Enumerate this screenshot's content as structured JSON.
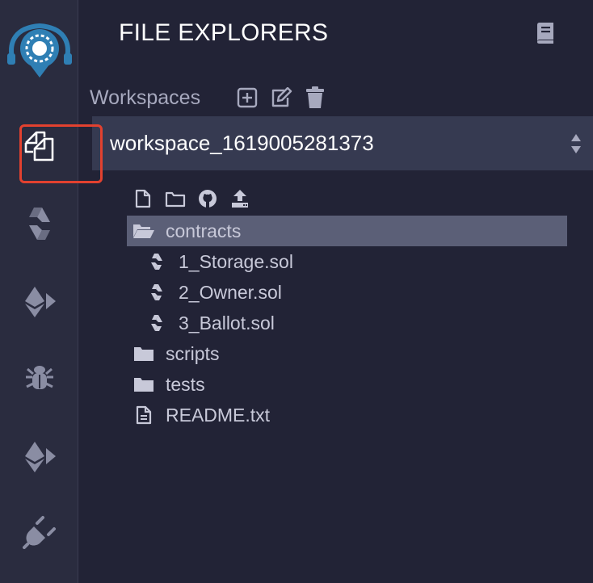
{
  "rail": {
    "items": [
      {
        "name": "remix-logo"
      },
      {
        "name": "file-explorer"
      },
      {
        "name": "solidity-compiler"
      },
      {
        "name": "deploy-run"
      },
      {
        "name": "debugger"
      },
      {
        "name": "ethereum-plugin"
      },
      {
        "name": "plugin-manager"
      }
    ]
  },
  "panel": {
    "title": "FILE EXPLORERS",
    "workspaces_label": "Workspaces",
    "workspace_selected": "workspace_1619005281373"
  },
  "tree": {
    "items": [
      {
        "label": "contracts",
        "type": "folder-open",
        "level": 0,
        "selected": true
      },
      {
        "label": "1_Storage.sol",
        "type": "solidity",
        "level": 1
      },
      {
        "label": "2_Owner.sol",
        "type": "solidity",
        "level": 1
      },
      {
        "label": "3_Ballot.sol",
        "type": "solidity",
        "level": 1
      },
      {
        "label": "scripts",
        "type": "folder",
        "level": 0
      },
      {
        "label": "tests",
        "type": "folder",
        "level": 0
      },
      {
        "label": "README.txt",
        "type": "file-text",
        "level": 0
      }
    ]
  },
  "colors": {
    "rail_bg": "#2a2c3f",
    "panel_bg": "#222336",
    "select_bg": "#363a51",
    "selected_row": "#5b5f77",
    "highlight": "#e2412f",
    "logo_blue": "#2f7fb4"
  }
}
